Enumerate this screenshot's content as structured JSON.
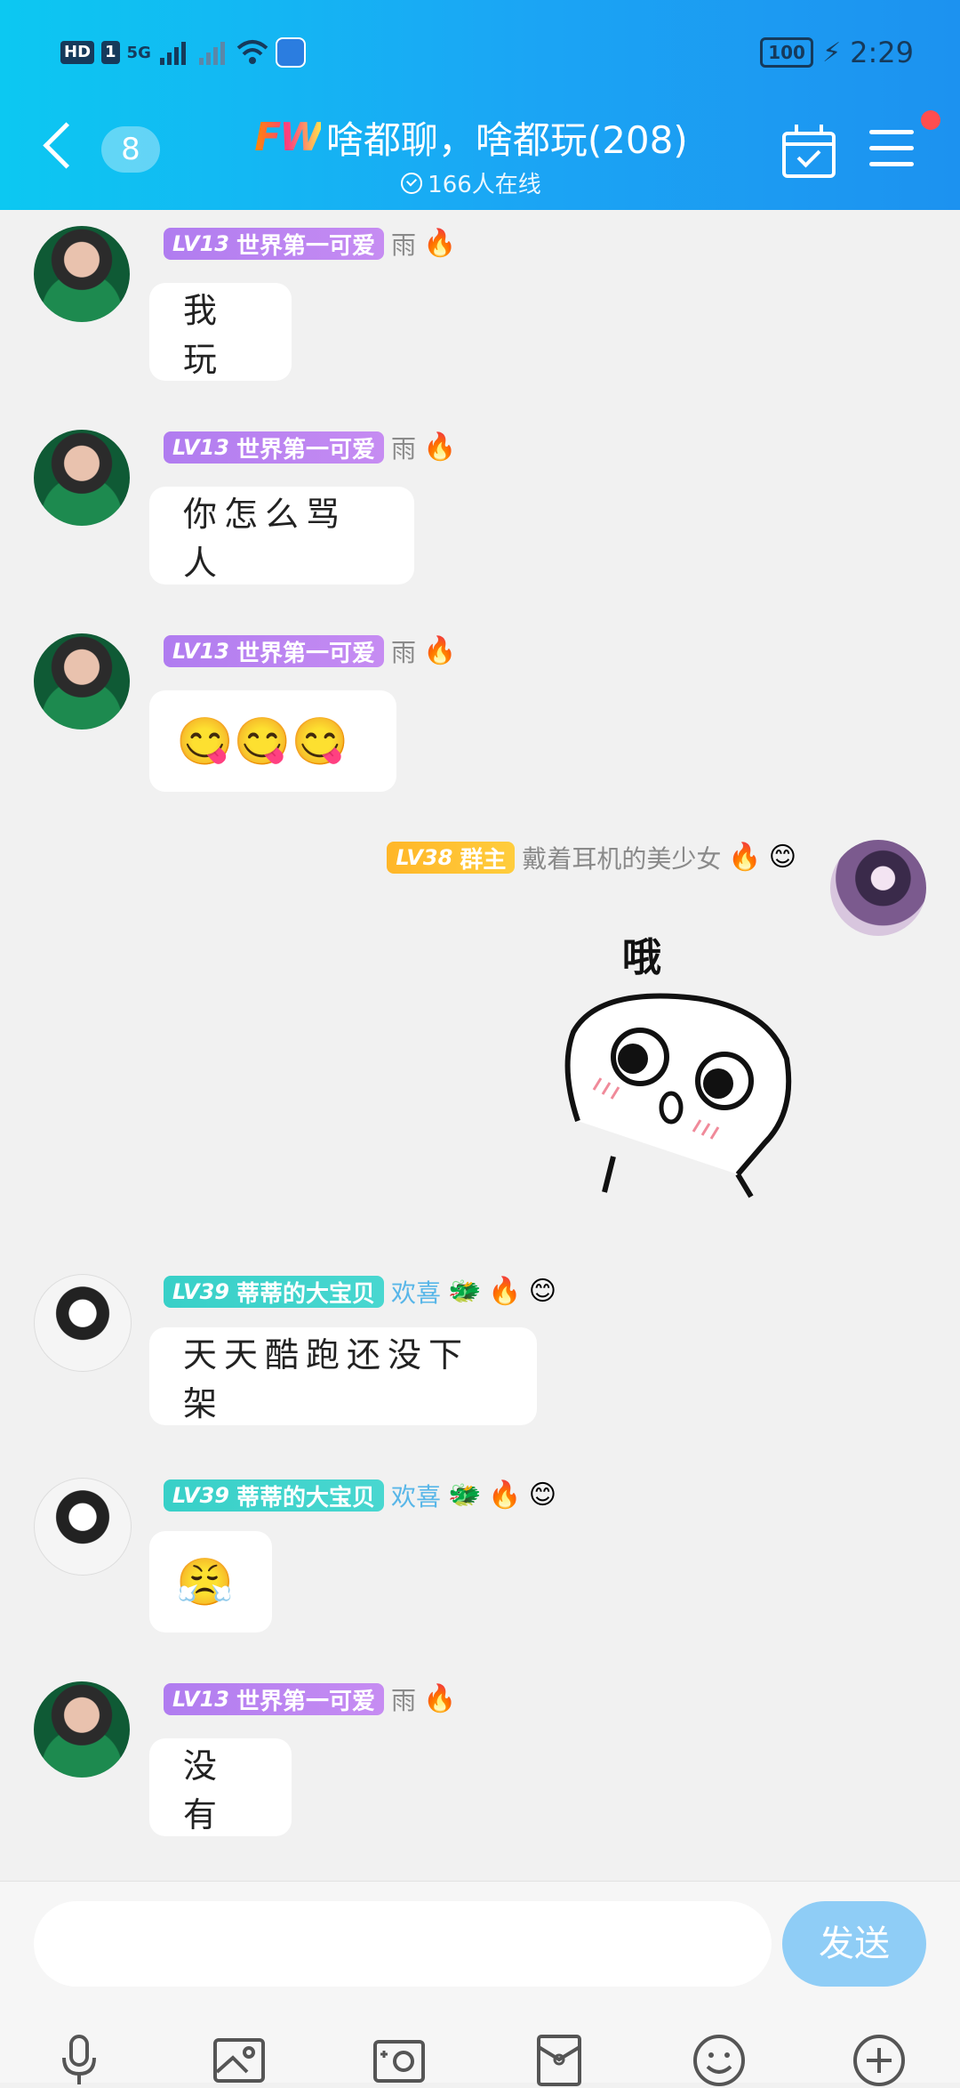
{
  "status_bar": {
    "left_indicators": [
      "HD",
      "1",
      "5G"
    ],
    "battery": "100",
    "time": "2:29"
  },
  "header": {
    "unread_count": "8",
    "group_prefix": "FW",
    "group_title": "啥都聊，啥都玩(208)",
    "online_text": "166人在线"
  },
  "messages": [
    {
      "level": "LV13",
      "title": "世界第一可爱",
      "nick": "雨",
      "text": "我玩"
    },
    {
      "level": "LV13",
      "title": "世界第一可爱",
      "nick": "雨",
      "text": "你怎么骂人"
    },
    {
      "level": "LV13",
      "title": "世界第一可爱",
      "nick": "雨",
      "text": "😋😋😋"
    },
    {
      "level": "LV38",
      "title": "群主",
      "nick": "戴着耳机的美少女",
      "sticker_text": "哦"
    },
    {
      "level": "LV39",
      "title": "蒂蒂的大宝贝",
      "nick": "欢喜",
      "text": "天天酷跑还没下架"
    },
    {
      "level": "LV39",
      "title": "蒂蒂的大宝贝",
      "nick": "欢喜",
      "text": "😤"
    },
    {
      "level": "LV13",
      "title": "世界第一可爱",
      "nick": "雨",
      "text": "没有"
    }
  ],
  "composer": {
    "input_value": "",
    "send_label": "发送"
  },
  "toolbar_icons": [
    "microphone-icon",
    "image-icon",
    "camera-icon",
    "red-packet-icon",
    "emoji-icon",
    "plus-icon"
  ],
  "colors": {
    "header_gradient": [
      "#0cc8f2",
      "#1c92f0"
    ],
    "lv13_badge": "#b07cf0",
    "lv39_badge": "#38d0c8",
    "owner_badge": "#ffb628",
    "send_button": "#8fcdf6"
  }
}
